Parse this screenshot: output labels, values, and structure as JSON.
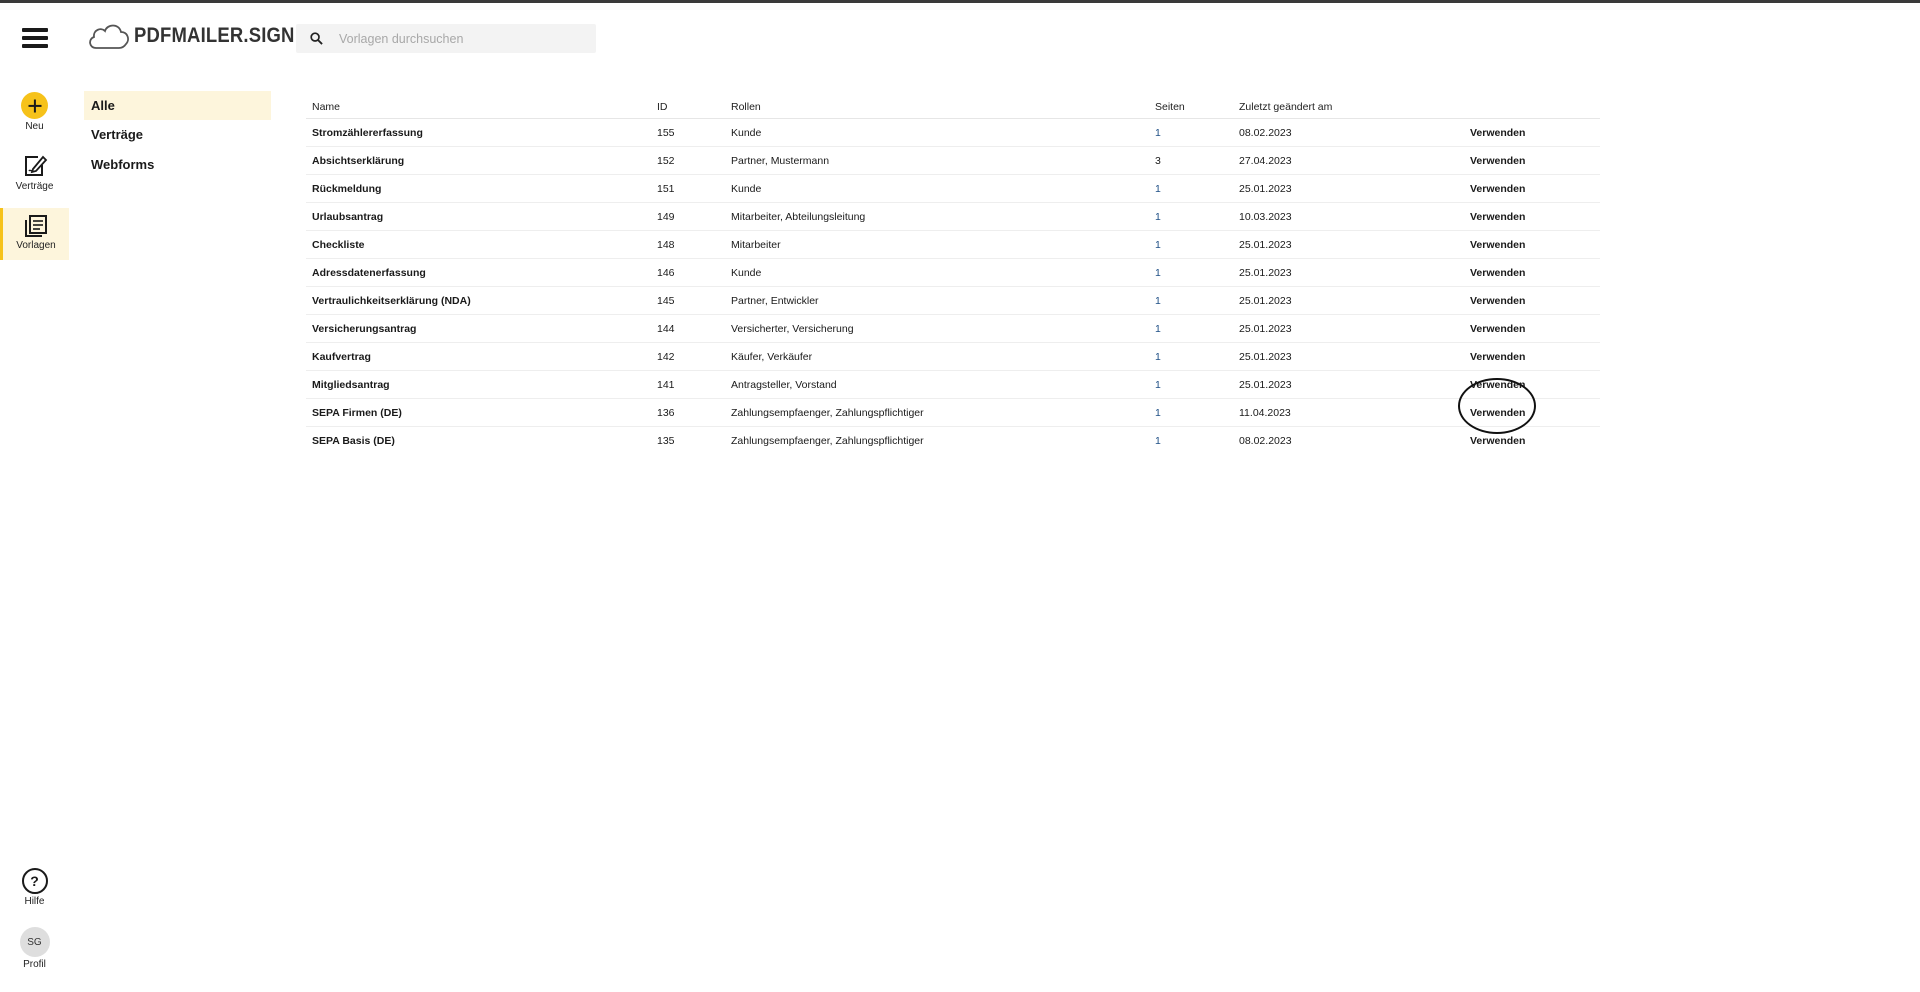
{
  "header": {
    "logo_text": "PDFMAILER.SIGN",
    "search": {
      "placeholder": "Vorlagen durchsuchen",
      "value": ""
    }
  },
  "rail": {
    "new_label": "Neu",
    "contracts_label": "Verträge",
    "templates_label": "Vorlagen",
    "help_label": "Hilfe",
    "profile_label": "Profil",
    "profile_initials": "SG"
  },
  "categories": [
    {
      "label": "Alle",
      "active": true
    },
    {
      "label": "Verträge",
      "active": false
    },
    {
      "label": "Webforms",
      "active": false
    }
  ],
  "table": {
    "columns": {
      "name": "Name",
      "id": "ID",
      "roles": "Rollen",
      "pages": "Seiten",
      "modified": "Zuletzt geändert am"
    },
    "rows": [
      {
        "name": "Stromzählererfassung",
        "id": "155",
        "roles": "Kunde",
        "pages": "1",
        "modified": "08.02.2023",
        "action": "Verwenden"
      },
      {
        "name": "Absichtserklärung",
        "id": "152",
        "roles": "Partner, Mustermann",
        "pages": "3",
        "modified": "27.04.2023",
        "action": "Verwenden"
      },
      {
        "name": "Rückmeldung",
        "id": "151",
        "roles": "Kunde",
        "pages": "1",
        "modified": "25.01.2023",
        "action": "Verwenden"
      },
      {
        "name": "Urlaubsantrag",
        "id": "149",
        "roles": "Mitarbeiter, Abteilungsleitung",
        "pages": "1",
        "modified": "10.03.2023",
        "action": "Verwenden"
      },
      {
        "name": "Checkliste",
        "id": "148",
        "roles": "Mitarbeiter",
        "pages": "1",
        "modified": "25.01.2023",
        "action": "Verwenden"
      },
      {
        "name": "Adressdatenerfassung",
        "id": "146",
        "roles": "Kunde",
        "pages": "1",
        "modified": "25.01.2023",
        "action": "Verwenden"
      },
      {
        "name": "Vertraulichkeitserklärung (NDA)",
        "id": "145",
        "roles": "Partner, Entwickler",
        "pages": "1",
        "modified": "25.01.2023",
        "action": "Verwenden"
      },
      {
        "name": "Versicherungsantrag",
        "id": "144",
        "roles": "Versicherter, Versicherung",
        "pages": "1",
        "modified": "25.01.2023",
        "action": "Verwenden"
      },
      {
        "name": "Kaufvertrag",
        "id": "142",
        "roles": "Käufer, Verkäufer",
        "pages": "1",
        "modified": "25.01.2023",
        "action": "Verwenden"
      },
      {
        "name": "Mitgliedsantrag",
        "id": "141",
        "roles": "Antragsteller, Vorstand",
        "pages": "1",
        "modified": "25.01.2023",
        "action": "Verwenden"
      },
      {
        "name": "SEPA Firmen (DE)",
        "id": "136",
        "roles": "Zahlungsempfaenger, Zahlungspflichtiger",
        "pages": "1",
        "modified": "11.04.2023",
        "action": "Verwenden"
      },
      {
        "name": "SEPA Basis (DE)",
        "id": "135",
        "roles": "Zahlungsempfaenger, Zahlungspflichtiger",
        "pages": "1",
        "modified": "08.02.2023",
        "action": "Verwenden"
      }
    ]
  },
  "colors": {
    "accent": "#f6c21a",
    "accent_light": "#fdf5dc",
    "pages_link": "#1f4f86"
  },
  "icons": [
    "menu-icon",
    "cloud-logo-icon",
    "search-icon",
    "plus-icon",
    "contract-edit-icon",
    "templates-icon",
    "help-icon"
  ]
}
